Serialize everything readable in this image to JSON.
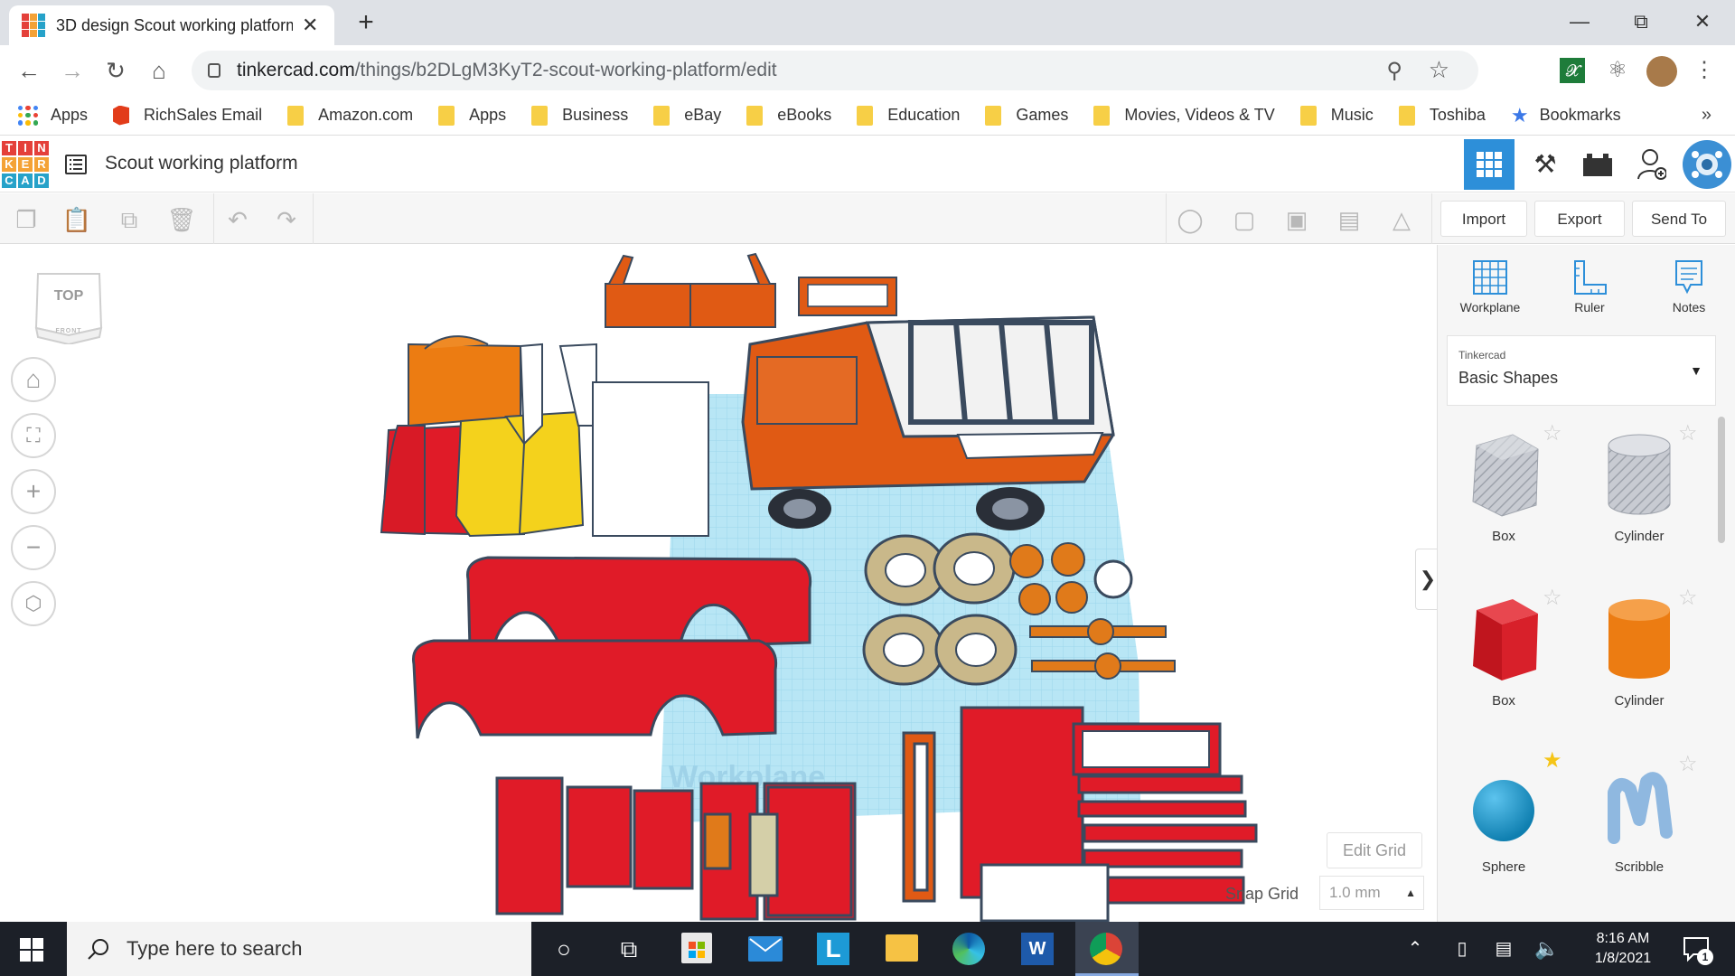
{
  "browser": {
    "tab_title": "3D design Scout working platform",
    "new_tab": "+",
    "tab_close": "✕",
    "url_host": "tinkercad.com",
    "url_path": "/things/b2DLgM3KyT2-scout-working-platform/edit",
    "bookmarks": [
      {
        "label": "Apps",
        "icon": "apps-grid-icon"
      },
      {
        "label": "RichSales Email",
        "icon": "office-icon"
      },
      {
        "label": "Amazon.com",
        "icon": "folder-icon"
      },
      {
        "label": "Apps",
        "icon": "folder-icon"
      },
      {
        "label": "Business",
        "icon": "folder-icon"
      },
      {
        "label": "eBay",
        "icon": "folder-icon"
      },
      {
        "label": "eBooks",
        "icon": "folder-icon"
      },
      {
        "label": "Education",
        "icon": "folder-icon"
      },
      {
        "label": "Games",
        "icon": "folder-icon"
      },
      {
        "label": "Movies, Videos & TV",
        "icon": "folder-icon"
      },
      {
        "label": "Music",
        "icon": "folder-icon"
      },
      {
        "label": "Toshiba",
        "icon": "folder-icon"
      },
      {
        "label": "Bookmarks",
        "icon": "star-icon"
      }
    ],
    "bookmarks_more": "»"
  },
  "app": {
    "logo_letters": [
      "T",
      "I",
      "N",
      "K",
      "E",
      "R",
      "C",
      "A",
      "D"
    ],
    "design_name": "Scout working platform",
    "toolbar": {
      "import": "Import",
      "export": "Export",
      "send_to": "Send To"
    }
  },
  "canvas": {
    "view_cube_top": "TOP",
    "view_cube_front": "FRONT",
    "workplane_label": "Workplane",
    "edit_grid": "Edit Grid",
    "snap_grid_label": "Snap Grid",
    "snap_grid_value": "1.0 mm",
    "collapse_arrow": "❯"
  },
  "panel": {
    "tools": [
      {
        "label": "Workplane",
        "icon": "workplane-icon"
      },
      {
        "label": "Ruler",
        "icon": "ruler-icon"
      },
      {
        "label": "Notes",
        "icon": "notes-icon"
      }
    ],
    "library_owner": "Tinkercad",
    "library_name": "Basic Shapes",
    "shapes": [
      {
        "label": "Box",
        "kind": "box-hole",
        "color": "#b9bcc4",
        "starred": false
      },
      {
        "label": "Cylinder",
        "kind": "cylinder-hole",
        "color": "#c4c7cd",
        "starred": false
      },
      {
        "label": "Box",
        "kind": "box",
        "color": "#d8202a",
        "starred": false
      },
      {
        "label": "Cylinder",
        "kind": "cylinder",
        "color": "#ec7c12",
        "starred": false
      },
      {
        "label": "Sphere",
        "kind": "sphere",
        "color": "#1692c4",
        "starred": true
      },
      {
        "label": "Scribble",
        "kind": "scribble",
        "color": "#8fb8e0",
        "starred": false
      }
    ]
  },
  "taskbar": {
    "search_placeholder": "Type here to search",
    "time": "8:16 AM",
    "date": "1/8/2021",
    "notification_count": "1"
  },
  "colors": {
    "accent_blue": "#2d8fd9",
    "design_orange": "#e05a14",
    "design_red": "#e01b28",
    "design_yellow": "#f4d21c",
    "grid_blue": "#aee3f3"
  }
}
